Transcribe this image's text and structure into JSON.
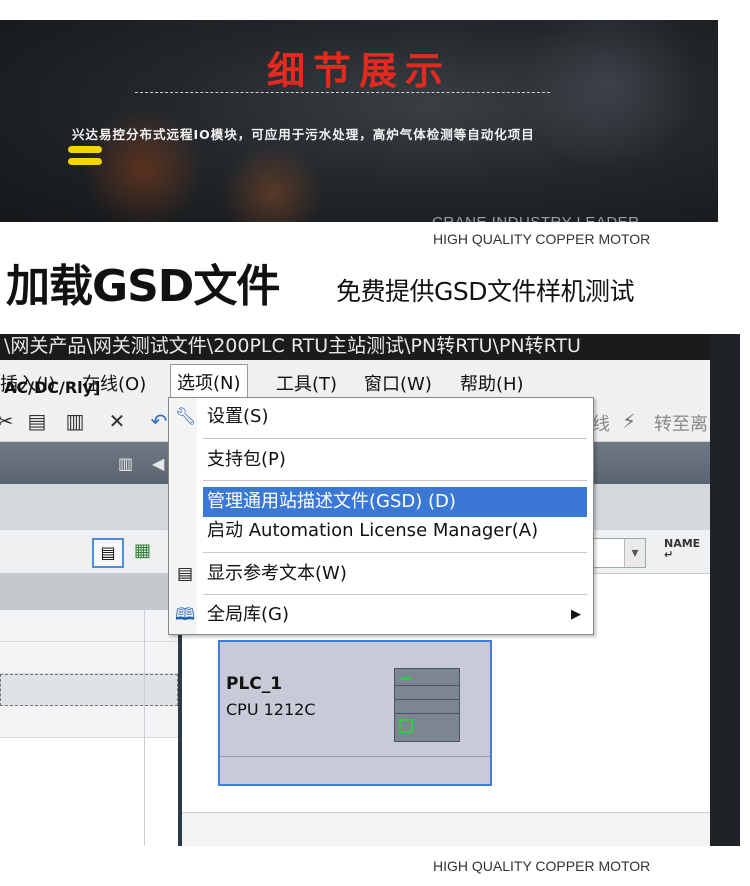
{
  "banner": {
    "title": "细节展示",
    "description": "兴达易控分布式远程IO模块，可应用于污水处理，高炉气体检测等自动化项目",
    "tagline": "CRANE INDUSTRY LEADER"
  },
  "header": {
    "brand_line_top": "HIGH QUALITY COPPER MOTOR",
    "title": "加载GSD文件",
    "subtitle": "免费提供GSD文件样机测试"
  },
  "software": {
    "title_bar": "\\网关产品\\网关测试文件\\200PLC RTU主站测试\\PN转RTU\\PN转RTU",
    "menu": [
      "插入(I)",
      "在线(O)",
      "选项(N)",
      "工具(T)",
      "窗口(W)",
      "帮助(H)"
    ],
    "toolbar_right_items": [
      "线",
      "转至离"
    ],
    "options_menu": [
      {
        "label": "设置(S)",
        "icon": "wrench-icon"
      },
      {
        "label": "支持包(P)",
        "icon": ""
      },
      {
        "label": "管理通用站描述文件(GSD) (D)",
        "icon": "",
        "highlighted": true
      },
      {
        "label": "启动 Automation License Manager(A)",
        "icon": ""
      },
      {
        "label": "显示参考文本(W)",
        "icon": "reference-text-icon"
      },
      {
        "label": "全局库(G)",
        "icon": "book-icon",
        "submenu": true
      }
    ],
    "left_pane_text": "AC/DC/Rly]",
    "row_name_label": "NAME",
    "plc": {
      "name": "PLC_1",
      "cpu": "CPU 1212C"
    }
  },
  "footer": {
    "brand_line_bottom": "HIGH QUALITY COPPER MOTOR"
  },
  "colors": {
    "banner_title": "#e42a1f",
    "accent_yellow": "#f5d400",
    "highlight_blue": "#3b78d6",
    "plc_border": "#3c7fd4"
  }
}
